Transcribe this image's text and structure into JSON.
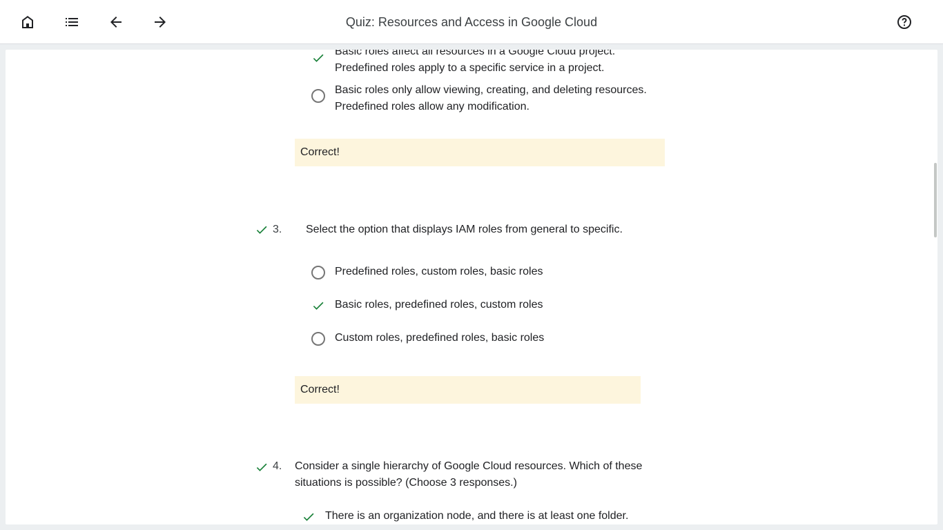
{
  "header": {
    "title": "Quiz: Resources and Access in Google Cloud",
    "icons": [
      "home-icon",
      "list-icon",
      "arrow-back-icon",
      "arrow-forward-icon",
      "help-icon"
    ]
  },
  "colors": {
    "check": "#188038",
    "feedback_bg": "#fdf5dd",
    "radio": "#757575"
  },
  "q2": {
    "options": [
      {
        "line1": "Basic roles affect all resources in a Google Cloud project.",
        "line2": "Predefined roles apply to a specific service in a project.",
        "state": "correct-selected"
      },
      {
        "line1": "Basic roles only allow viewing, creating, and deleting resources.",
        "line2": "Predefined roles allow any modification.",
        "state": "unselected"
      }
    ],
    "feedback": "Correct!"
  },
  "q3": {
    "number": "3.",
    "text": "Select the option that displays IAM roles from general to specific.",
    "options": [
      {
        "label": "Predefined roles, custom roles, basic roles",
        "state": "unselected"
      },
      {
        "label": "Basic roles, predefined roles, custom roles",
        "state": "correct-selected"
      },
      {
        "label": "Custom roles, predefined roles, basic roles",
        "state": "unselected"
      }
    ],
    "feedback": "Correct!"
  },
  "q4": {
    "number": "4.",
    "text_line1": "Consider a single hierarchy of Google Cloud resources. Which of these",
    "text_line2": "situations is possible? (Choose 3 responses.)",
    "options": [
      {
        "label": "There is an organization node, and there is at least one folder.",
        "state": "correct-selected"
      }
    ]
  }
}
